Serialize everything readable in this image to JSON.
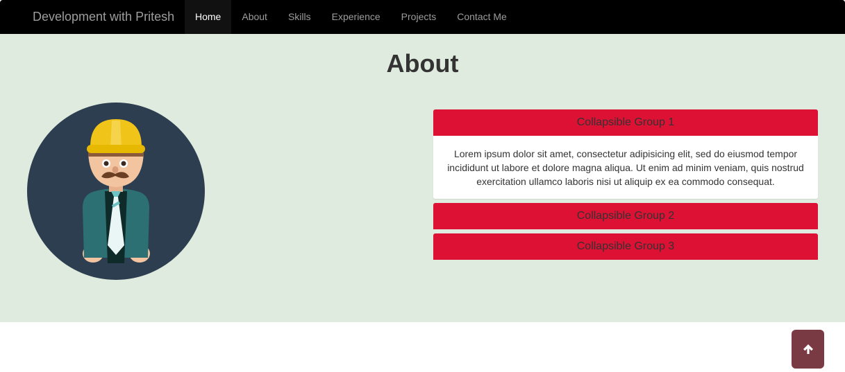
{
  "navbar": {
    "brand": "Development with Pritesh",
    "items": [
      {
        "label": "Home",
        "active": true
      },
      {
        "label": "About",
        "active": false
      },
      {
        "label": "Skills",
        "active": false
      },
      {
        "label": "Experience",
        "active": false
      },
      {
        "label": "Projects",
        "active": false
      },
      {
        "label": "Contact Me",
        "active": false
      }
    ]
  },
  "about": {
    "title": "About",
    "avatar_icon": "worker-avatar-icon",
    "accordion": [
      {
        "title": "Collapsible Group 1",
        "expanded": true,
        "body": "Lorem ipsum dolor sit amet, consectetur adipisicing elit, sed do eiusmod tempor incididunt ut labore et dolore magna aliqua. Ut enim ad minim veniam, quis nostrud exercitation ullamco laboris nisi ut aliquip ex ea commodo consequat."
      },
      {
        "title": "Collapsible Group 2",
        "expanded": false
      },
      {
        "title": "Collapsible Group 3",
        "expanded": false
      }
    ]
  },
  "scroll_top": {
    "icon": "arrow-up-icon"
  },
  "colors": {
    "navbar_bg": "#000000",
    "section_bg": "#dfebdf",
    "accordion_header": "#dc1133",
    "scroll_button": "#7a3a43"
  }
}
